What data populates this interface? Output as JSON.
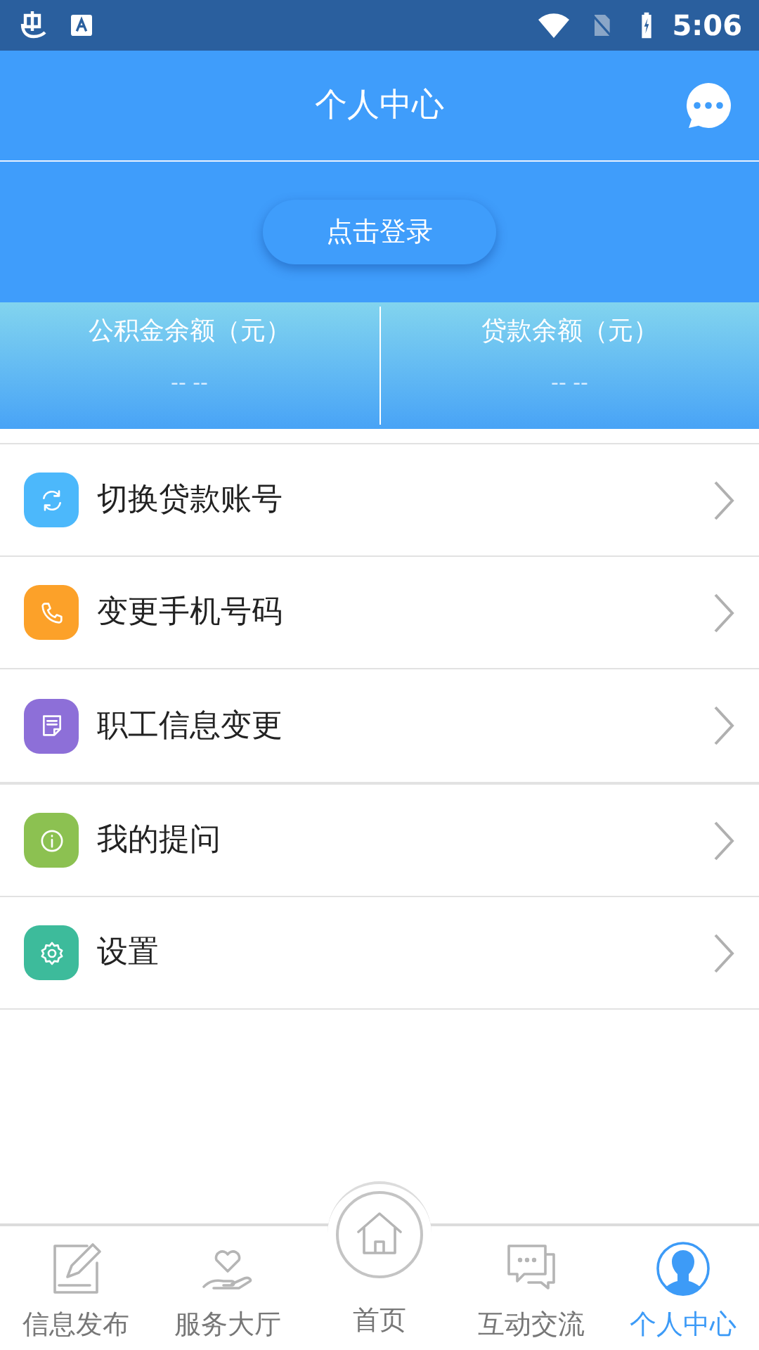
{
  "status_bar": {
    "time": "5:06"
  },
  "header": {
    "title": "个人中心"
  },
  "login_button": "点击登录",
  "balances": [
    {
      "label": "公积金余额（元）",
      "value": "-- --"
    },
    {
      "label": "贷款余额（元）",
      "value": "-- --"
    }
  ],
  "menu_groups": [
    [
      {
        "label": "切换贷款账号",
        "color": "#4cb8fb"
      },
      {
        "label": "变更手机号码",
        "color": "#fca129"
      },
      {
        "label": "职工信息变更",
        "color": "#8d6fd8"
      }
    ],
    [
      {
        "label": "我的提问",
        "color": "#8cc151"
      },
      {
        "label": "设置",
        "color": "#3dbb9b"
      }
    ]
  ],
  "bottom_nav": [
    {
      "label": "信息发布",
      "kind": "tab",
      "selected": false
    },
    {
      "label": "服务大厅",
      "kind": "tab",
      "selected": false
    },
    {
      "label": "首页",
      "kind": "center",
      "selected": false
    },
    {
      "label": "互动交流",
      "kind": "tab",
      "selected": false
    },
    {
      "label": "个人中心",
      "kind": "tab",
      "selected": true
    }
  ]
}
